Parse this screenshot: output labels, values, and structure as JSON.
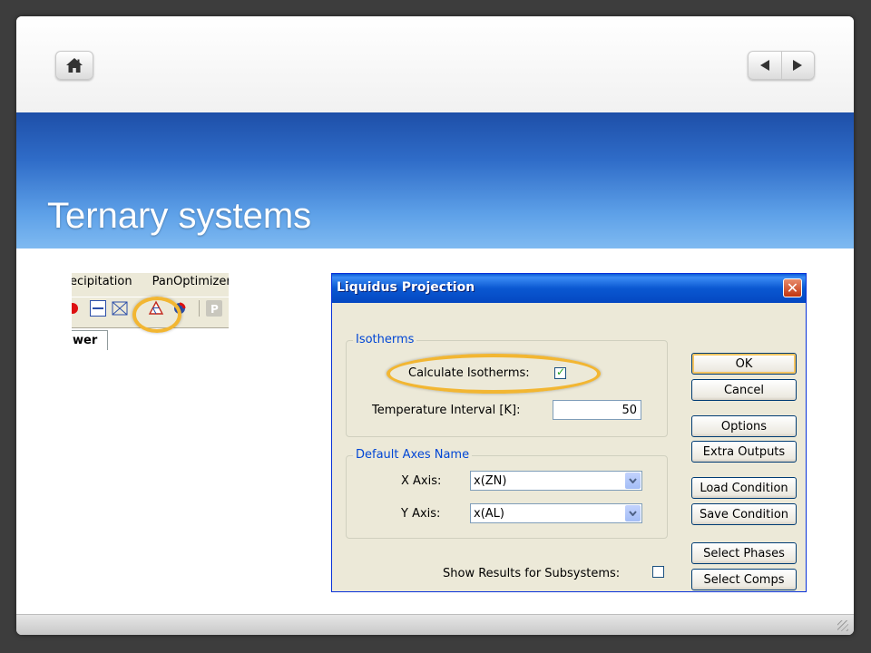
{
  "slide": {
    "title": "Ternary systems",
    "nav": {
      "home_icon": "home-icon",
      "prev_icon": "triangle-left-icon",
      "next_icon": "triangle-right-icon"
    }
  },
  "toolbar_crop": {
    "menu_items": [
      "ecipitation",
      "PanOptimizer"
    ],
    "tab_label": "wer",
    "highlight_color": "#f2b632"
  },
  "dialog": {
    "title": "Liquidus Projection",
    "isotherms": {
      "group_label": "Isotherms",
      "calc_label": "Calculate Isotherms:",
      "calc_checked": true,
      "temp_label": "Temperature Interval [K]:",
      "temp_value": "50"
    },
    "axes": {
      "group_label": "Default Axes Name",
      "x_label": "X Axis:",
      "x_value": "x(ZN)",
      "y_label": "Y Axis:",
      "y_value": "x(AL)"
    },
    "subsystems": {
      "label": "Show Results for Subsystems:",
      "checked": false
    },
    "buttons": {
      "ok": "OK",
      "cancel": "Cancel",
      "options": "Options",
      "extra_outputs": "Extra Outputs",
      "load_condition": "Load Condition",
      "save_condition": "Save Condition",
      "select_phases": "Select Phases",
      "select_comps": "Select Comps"
    },
    "colors": {
      "titlebar": "#0a58d1",
      "group_label": "#0046d5",
      "highlight": "#f2b632"
    }
  }
}
